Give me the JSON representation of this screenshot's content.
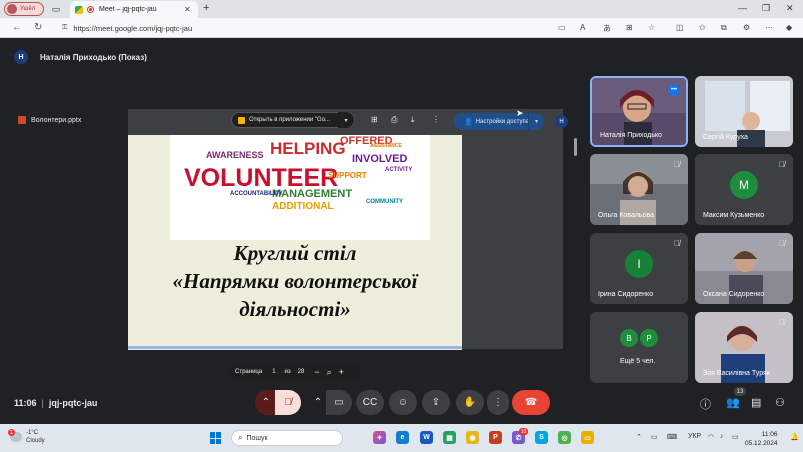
{
  "browser": {
    "profile_label": "Ушёл",
    "tab_title": "Meet – jqj-pqtc-jau",
    "url": "https://meet.google.com/jqj-pqtc-jau"
  },
  "meet": {
    "presenter_initial": "Н",
    "presenter_title": "Наталія Приходько (Показ)",
    "file_name": "Волонтери.pptx",
    "open_in_app": "Открыть в приложении \"Go...",
    "access_settings": "Настройки доступа",
    "user_initial": "Н",
    "slide": {
      "cloud_words": [
        "AWARENESS",
        "HELPING",
        "VOLUNTEER",
        "MANAGEMENT",
        "OFFERED",
        "INVOLVED",
        "SUPPORT",
        "ADDITIONAL",
        "ACCOUNTABILITY",
        "ASSISTANCE",
        "ACTIVITY",
        "COMMUNITY"
      ],
      "title_line1": "Круглий стіл",
      "title_line2": "«Напрямки  волонтерської",
      "title_line3": "діяльності»"
    },
    "pager": {
      "label": "Страница",
      "current": "1",
      "of": "из",
      "total": "28",
      "zoom_out": "−",
      "zoom_in": "+"
    },
    "participants": [
      {
        "name": "Наталія Приходько",
        "type": "photo",
        "speaking": true
      },
      {
        "name": "Сергій Куруха",
        "type": "photo"
      },
      {
        "name": "Ольга Ковальова",
        "type": "photo"
      },
      {
        "name": "Максим Кузьменко",
        "type": "avatar",
        "initial": "М",
        "color": "#1e8e3e"
      },
      {
        "name": "Ірина Сидоренко",
        "type": "avatar",
        "initial": "І",
        "color": "#188038"
      },
      {
        "name": "Оксана Сидоренко",
        "type": "photo"
      },
      {
        "name": "Ещё 5 чел.",
        "type": "group",
        "initials": [
          "В",
          "Р"
        ]
      },
      {
        "name": "Зоя Василівна Туряк",
        "type": "photo"
      }
    ],
    "time": "11:06",
    "meeting_code": "jqj-pqtc-jau",
    "people_count": "13"
  },
  "taskbar": {
    "weather_badge": "1",
    "temperature": "-1°C",
    "weather": "Cloudy",
    "search_placeholder": "Пошук",
    "notif_count": "10",
    "language": "УКР",
    "clock_time": "11:06",
    "clock_date": "05.12.2024"
  }
}
